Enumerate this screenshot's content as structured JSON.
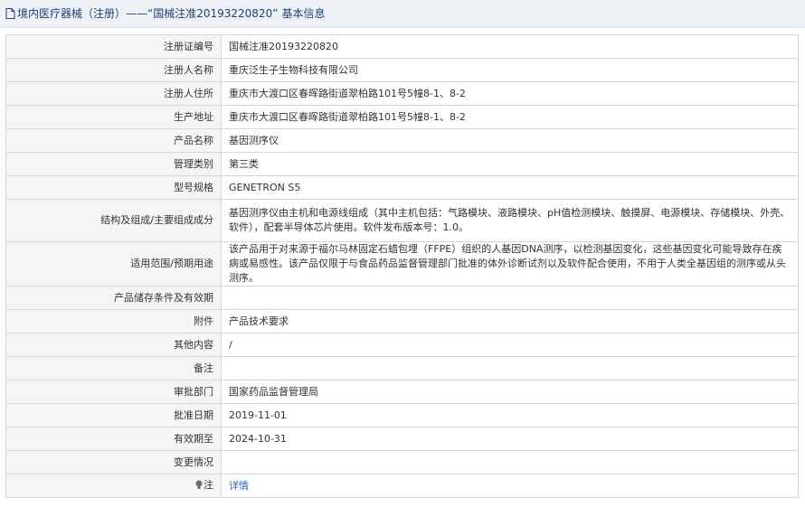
{
  "header": {
    "title_prefix": "境内医疗器械（注册）——",
    "title_quoted": "“国械注准20193220820”",
    "title_suffix": "基本信息"
  },
  "rows": [
    {
      "label": "注册证编号",
      "value": "国械注准20193220820"
    },
    {
      "label": "注册人名称",
      "value": "重庆泛生子生物科技有限公司"
    },
    {
      "label": "注册人住所",
      "value": "重庆市大渡口区春晖路街道翠柏路101号5幢8-1、8-2"
    },
    {
      "label": "生产地址",
      "value": "重庆市大渡口区春晖路街道翠柏路101号5幢8-1、8-2"
    },
    {
      "label": "产品名称",
      "value": "基因测序仪"
    },
    {
      "label": "管理类别",
      "value": "第三类"
    },
    {
      "label": "型号规格",
      "value": "GENETRON S5"
    },
    {
      "label": "结构及组成/主要组成成分",
      "value": "基因测序仪由主机和电源线组成（其中主机包括：气路模块、液路模块、pH值检测模块、触摸屏、电源模块、存储模块、外壳、软件），配套半导体芯片使用。软件发布版本号：1.0。"
    },
    {
      "label": "适用范围/预期用途",
      "value": "该产品用于对来源于福尔马林固定石蜡包埋（FFPE）组织的人基因DNA测序，以检测基因变化，这些基因变化可能导致存在疾病或易感性。该产品仅限于与食品药品监督管理部门批准的体外诊断试剂以及软件配合使用，不用于人类全基因组的测序或从头测序。"
    },
    {
      "label": "产品储存条件及有效期",
      "value": ""
    },
    {
      "label": "附件",
      "value": "产品技术要求"
    },
    {
      "label": "其他内容",
      "value": "/"
    },
    {
      "label": "备注",
      "value": ""
    },
    {
      "label": "审批部门",
      "value": "国家药品监督管理局"
    },
    {
      "label": "批准日期",
      "value": "2019-11-01"
    },
    {
      "label": "有效期至",
      "value": "2024-10-31"
    },
    {
      "label": "变更情况",
      "value": ""
    }
  ],
  "note_row": {
    "label": "注",
    "link": "详情"
  },
  "colors": {
    "header_bg": "#eef1f6",
    "title_text": "#1f3f78",
    "label_bg": "#f5f5f5",
    "border": "#d6d6d6",
    "link": "#2a63b8"
  },
  "icons": {
    "title": "document-icon",
    "note": "lightbulb-icon"
  }
}
